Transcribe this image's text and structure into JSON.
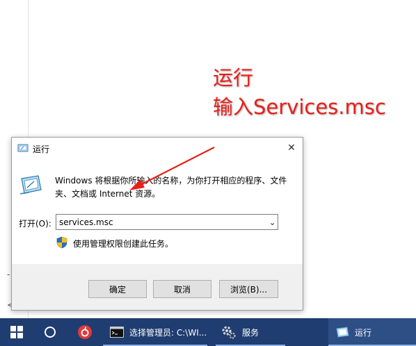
{
  "background": {
    "glyphs": [
      "-",
      "<"
    ]
  },
  "annotation": {
    "line1": "运行",
    "line2": "输入Services.msc",
    "color": "#e8201a"
  },
  "dialog": {
    "title": "运行",
    "close_glyph": "✕",
    "description": "Windows 将根据你所输入的名称，为你打开相应的程序、文件夹、文档或 Internet 资源。",
    "open_label": "打开(O):",
    "input_value": "services.msc",
    "dropdown_glyph": "⌄",
    "admin_text": "使用管理权限创建此任务。",
    "buttons": {
      "ok": "确定",
      "cancel": "取消",
      "browse": "浏览(B)..."
    }
  },
  "taskbar": {
    "cmd_label": "选择管理员: C:\\WI...",
    "services_label": "服务",
    "run_label": "运行",
    "background_color": "#1f3d70"
  }
}
